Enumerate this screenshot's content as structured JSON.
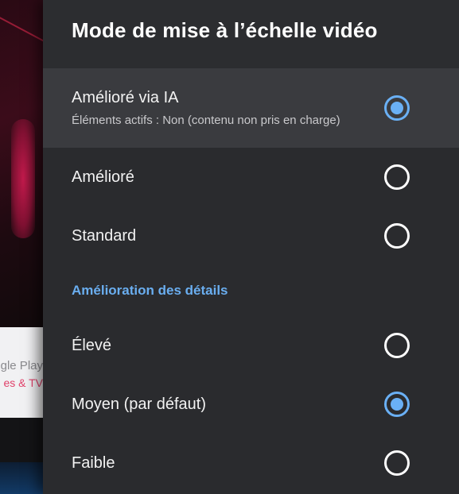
{
  "background": {
    "card_line1": "gle Play",
    "card_line2": "es & TV"
  },
  "panel": {
    "title": "Mode de mise à l’échelle vidéo",
    "scaling_options": [
      {
        "label": "Amélioré via IA",
        "sublabel": "Éléments actifs : Non (contenu non pris en charge)",
        "selected": true
      },
      {
        "label": "Amélioré",
        "selected": false
      },
      {
        "label": "Standard",
        "selected": false
      }
    ],
    "detail_section_title": "Amélioration des détails",
    "detail_options": [
      {
        "label": "Élevé",
        "selected": false
      },
      {
        "label": "Moyen (par défaut)",
        "selected": true
      },
      {
        "label": "Faible",
        "selected": false
      }
    ]
  },
  "colors": {
    "accent": "#6ab0f5",
    "panel_bg": "#2a2b2e",
    "focused_row_bg": "#3a3b3f"
  }
}
